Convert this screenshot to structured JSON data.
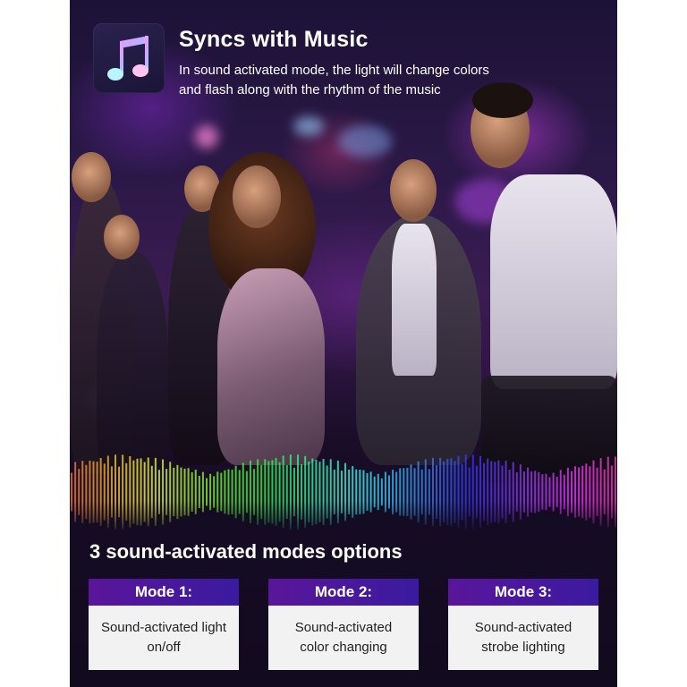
{
  "header": {
    "icon": "music-note-icon",
    "title": "Syncs with Music",
    "description_lines": [
      "In sound activated mode, the light will change colors",
      "and flash along with the rhythm of the music"
    ]
  },
  "modes": {
    "title": "3 sound-activated modes options",
    "items": [
      {
        "label": "Mode 1:",
        "lines": [
          "Sound-activated light",
          "on/off"
        ]
      },
      {
        "label": "Mode 2:",
        "lines": [
          "Sound-activated",
          "color changing"
        ]
      },
      {
        "label": "Mode 3:",
        "lines": [
          "Sound-activated",
          "strobe lighting"
        ]
      }
    ]
  },
  "colors": {
    "card_header": "#4a1aa0",
    "card_body": "#f2f2f2",
    "background": "#140a22"
  }
}
